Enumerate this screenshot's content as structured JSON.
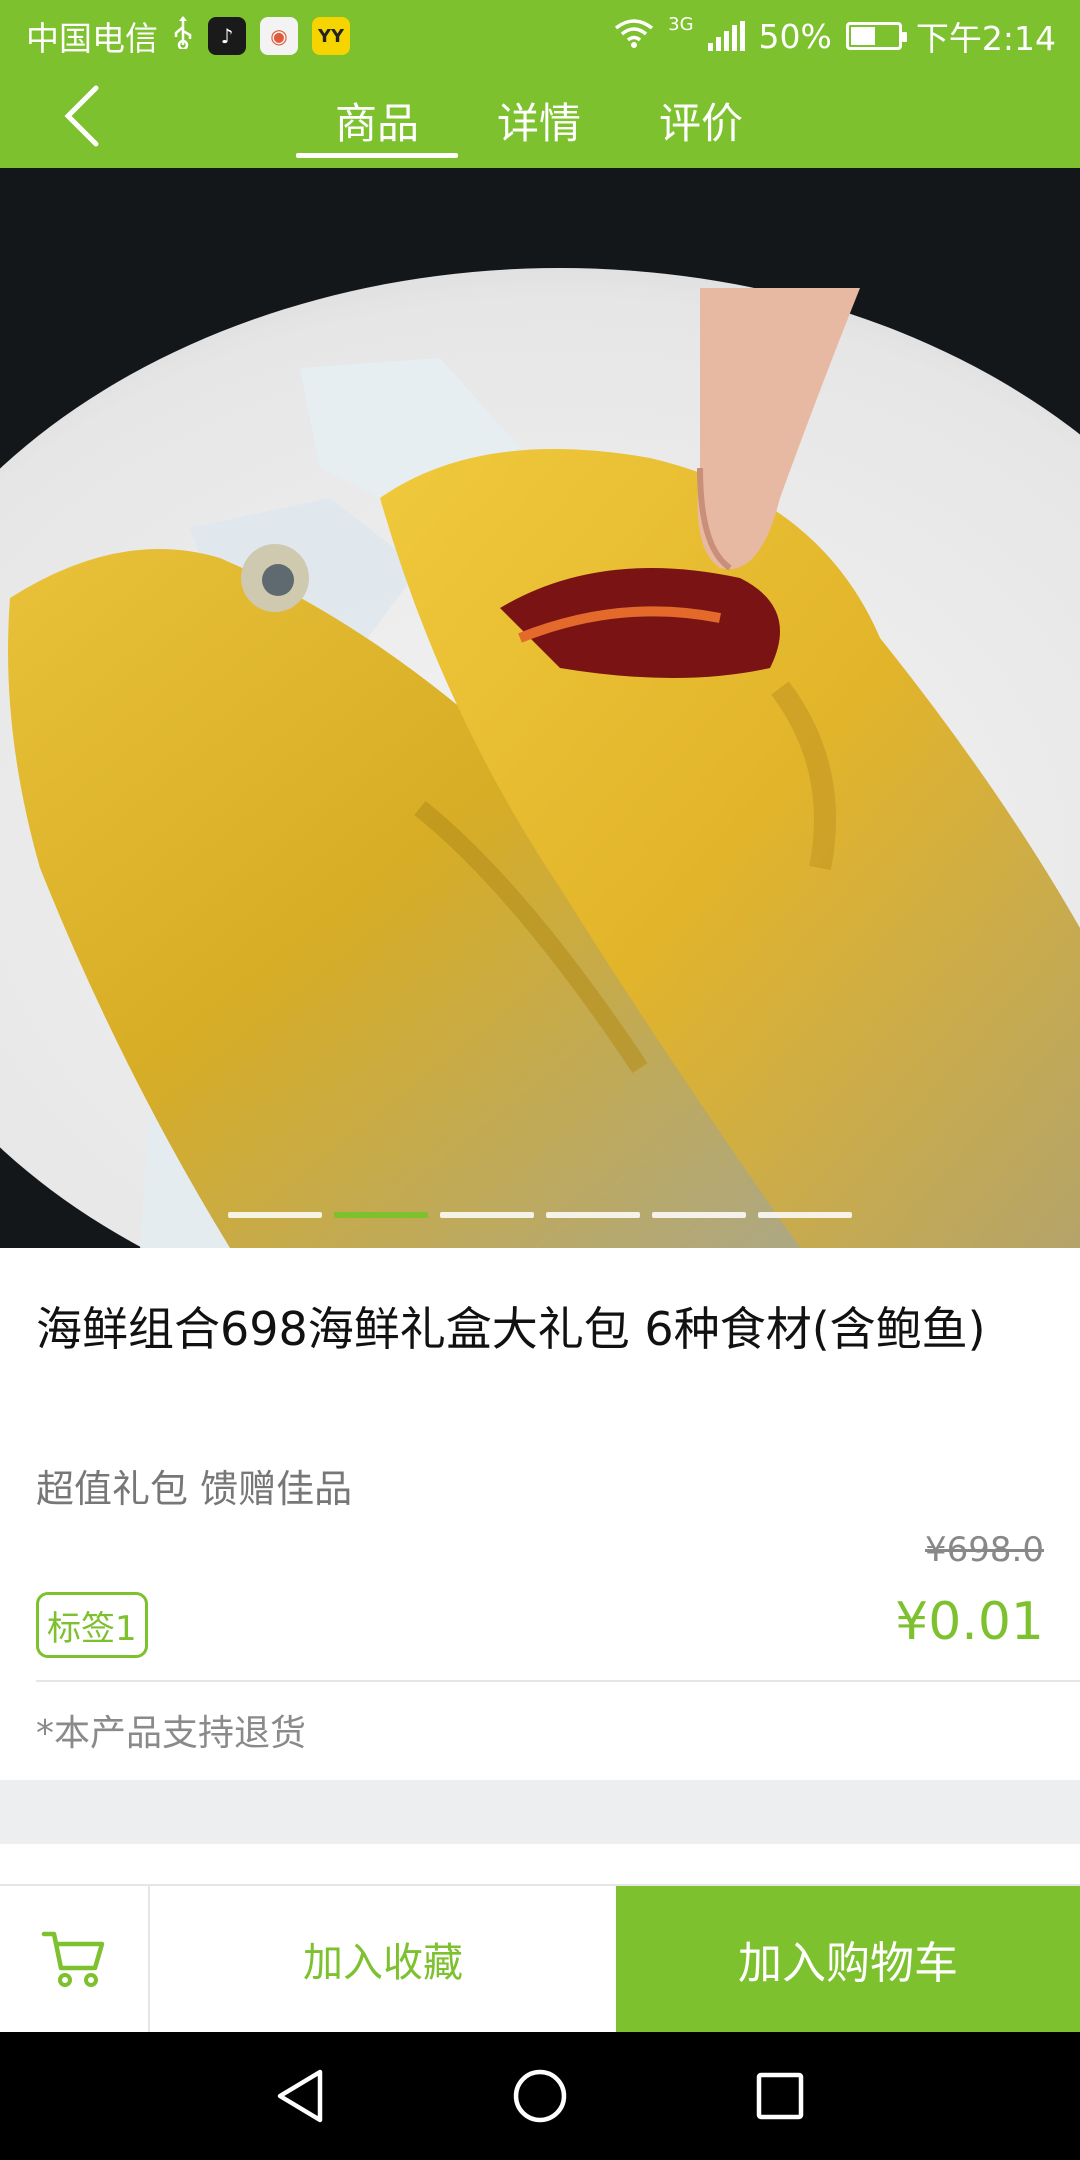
{
  "status_bar": {
    "carrier": "中国电信",
    "usb_icon": "usb-icon",
    "app_badges": [
      {
        "name": "tiktok-icon",
        "glyph": "♪"
      },
      {
        "name": "map-app-icon",
        "glyph": "◉"
      },
      {
        "name": "yy-app-icon",
        "glyph": "YY"
      }
    ],
    "network_type": "3G",
    "battery": "50%",
    "time": "下午2:14"
  },
  "header": {
    "tabs": [
      {
        "label": "商品",
        "active": true
      },
      {
        "label": "详情",
        "active": false
      },
      {
        "label": "评价",
        "active": false
      }
    ]
  },
  "carousel": {
    "total": 6,
    "active_index": 1
  },
  "product": {
    "title": "海鲜组合698海鲜礼盒大礼包 6种食材(含鲍鱼)",
    "subtitle": "超值礼包 馈赠佳品",
    "original_price": "¥698.0",
    "tag": "标签1",
    "price": "¥0.01",
    "note": "*本产品支持退货"
  },
  "actions": {
    "cart_icon": "cart-icon",
    "favorite_label": "加入收藏",
    "add_to_cart_label": "加入购物车"
  },
  "colors": {
    "accent": "#7dc12f",
    "navbar": "#000000",
    "divider": "#e6e6e6"
  }
}
